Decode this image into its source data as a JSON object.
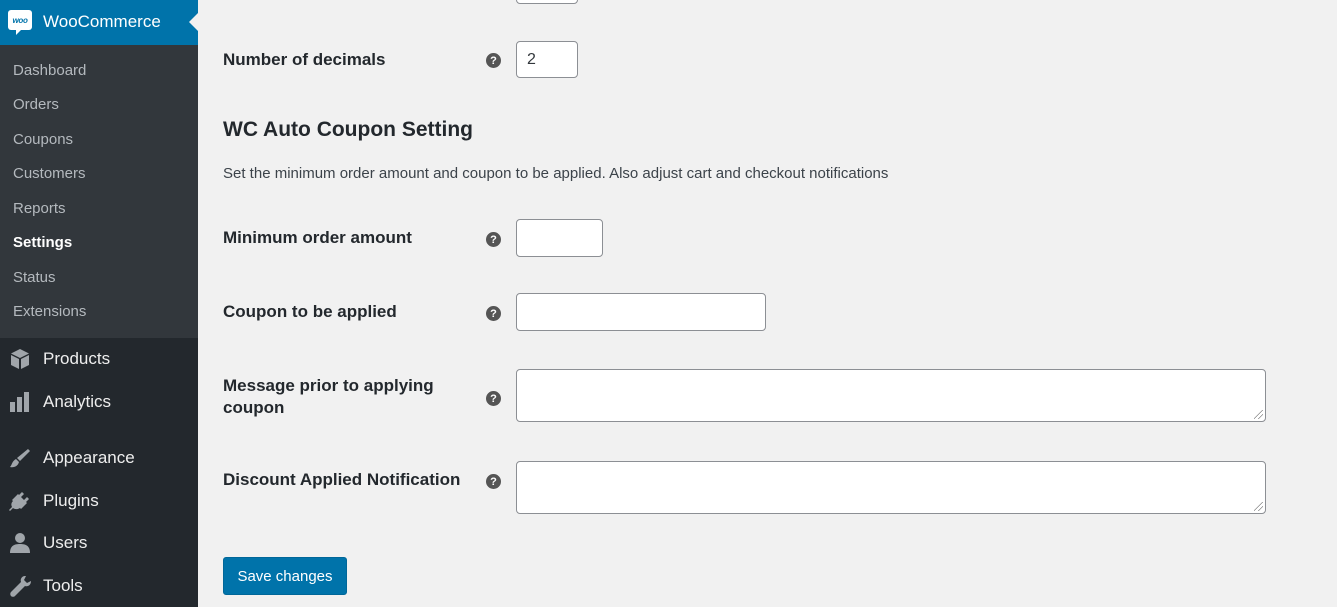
{
  "header": {
    "app_name": "WooCommerce",
    "logo_text": "woo"
  },
  "submenu": [
    {
      "label": "Dashboard",
      "current": false
    },
    {
      "label": "Orders",
      "current": false
    },
    {
      "label": "Coupons",
      "current": false
    },
    {
      "label": "Customers",
      "current": false
    },
    {
      "label": "Reports",
      "current": false
    },
    {
      "label": "Settings",
      "current": true
    },
    {
      "label": "Status",
      "current": false
    },
    {
      "label": "Extensions",
      "current": false
    }
  ],
  "menu": [
    {
      "label": "Products",
      "icon": "box-icon"
    },
    {
      "label": "Analytics",
      "icon": "bar-chart-icon"
    },
    {
      "label": "Appearance",
      "icon": "paintbrush-icon"
    },
    {
      "label": "Plugins",
      "icon": "plug-icon"
    },
    {
      "label": "Users",
      "icon": "user-icon"
    },
    {
      "label": "Tools",
      "icon": "wrench-icon"
    }
  ],
  "decimals": {
    "label": "Number of decimals",
    "value": "2"
  },
  "section": {
    "title": "WC Auto Coupon Setting",
    "description": "Set the minimum order amount and coupon to be applied. Also adjust cart and checkout notifications"
  },
  "fields": {
    "min_order": {
      "label": "Minimum order amount",
      "value": ""
    },
    "coupon": {
      "label": "Coupon to be applied",
      "value": ""
    },
    "message_prior": {
      "label_line1": "Message prior to applying",
      "label_line2": "coupon",
      "value": ""
    },
    "discount_notice": {
      "label": "Discount Applied Notification",
      "value": ""
    }
  },
  "help_glyph": "?",
  "save_label": "Save changes",
  "colors": {
    "accent": "#0073aa",
    "sidebar_bg": "#23282d",
    "submenu_bg": "#32373c",
    "content_bg": "#f1f1f1"
  }
}
